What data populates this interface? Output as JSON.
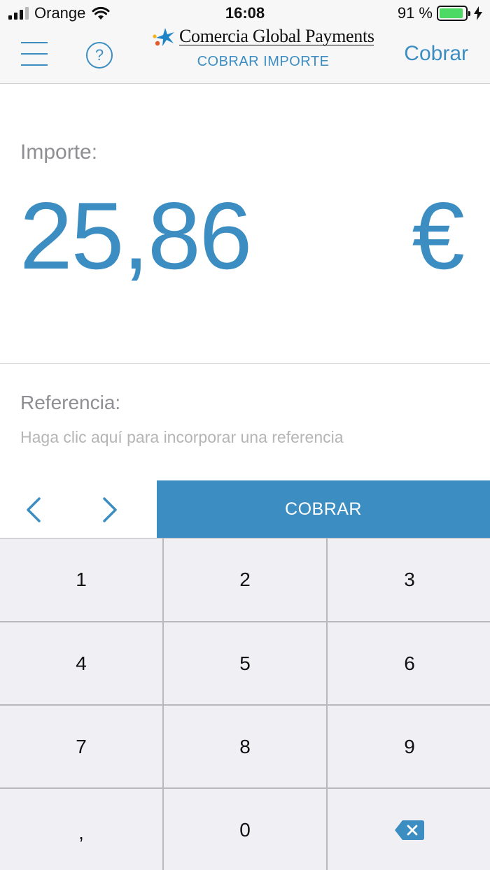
{
  "status_bar": {
    "carrier": "Orange",
    "time": "16:08",
    "battery_percent": "91 %",
    "battery_level": 0.91,
    "signal_bars_filled": 3,
    "signal_bars_total": 4
  },
  "nav": {
    "brand_name": "Comercia Global Payments",
    "subtitle": "COBRAR IMPORTE",
    "help_label": "?",
    "action_label": "Cobrar"
  },
  "amount": {
    "label": "Importe:",
    "value": "25,86",
    "currency": "€"
  },
  "reference": {
    "label": "Referencia:",
    "placeholder": "Haga clic aquí para incorporar una referencia"
  },
  "action_bar": {
    "charge_label": "COBRAR"
  },
  "keypad": {
    "keys": [
      "1",
      "2",
      "3",
      "4",
      "5",
      "6",
      "7",
      "8",
      "9",
      ",",
      "0"
    ]
  },
  "colors": {
    "accent": "#3c8dc2",
    "key_background": "#f0f0f4",
    "battery": "#4cd964"
  }
}
